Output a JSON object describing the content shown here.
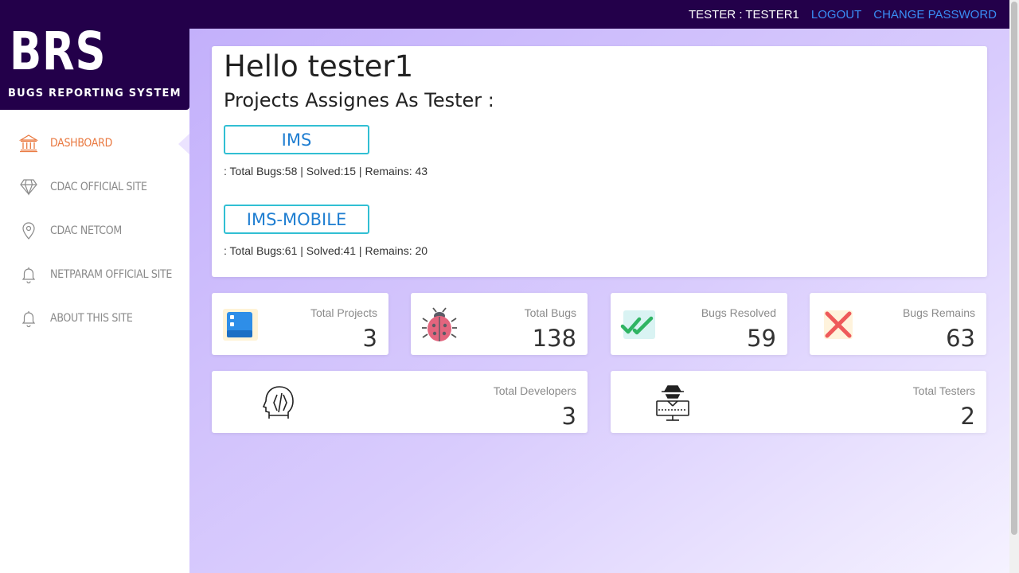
{
  "header": {
    "user_label": "TESTER : TESTER1",
    "logout_label": "LOGOUT",
    "change_password_label": "CHANGE PASSWORD"
  },
  "brand": {
    "logo_text": "BRS",
    "tagline": "BUGS REPORTING SYSTEM"
  },
  "sidebar": {
    "items": [
      {
        "label": "DASHBOARD",
        "icon": "bank-icon",
        "active": true
      },
      {
        "label": "CDAC OFFICIAL SITE",
        "icon": "diamond-icon",
        "active": false
      },
      {
        "label": "CDAC NETCOM",
        "icon": "location-pin-icon",
        "active": false
      },
      {
        "label": "NETPARAM OFFICIAL SITE",
        "icon": "bell-icon",
        "active": false
      },
      {
        "label": "ABOUT THIS SITE",
        "icon": "bell-icon",
        "active": false
      }
    ]
  },
  "greeting": {
    "title": "Hello tester1",
    "subtitle": "Projects Assignes As Tester :"
  },
  "projects": [
    {
      "name": "IMS",
      "stats": ": Total Bugs:58 | Solved:15 | Remains: 43"
    },
    {
      "name": "IMS-MOBILE",
      "stats": ": Total Bugs:61 | Solved:41 | Remains: 20"
    }
  ],
  "stats": [
    {
      "title": "Total Projects",
      "value": "3",
      "icon": "projects-icon"
    },
    {
      "title": "Total Bugs",
      "value": "138",
      "icon": "bug-icon"
    },
    {
      "title": "Bugs Resolved",
      "value": "59",
      "icon": "double-check-icon"
    },
    {
      "title": "Bugs Remains",
      "value": "63",
      "icon": "cross-icon"
    },
    {
      "title": "Total Developers",
      "value": "3",
      "icon": "developer-head-icon"
    },
    {
      "title": "Total Testers",
      "value": "2",
      "icon": "tester-spy-icon"
    }
  ],
  "colors": {
    "topbar": "#23004a",
    "link": "#3a8ef6",
    "active_nav": "#e9783f",
    "project_border": "#31bfd3",
    "project_text": "#1f7ed1",
    "bg_gradient_start": "#c3b0fb",
    "bg_gradient_end": "#f5f2ff"
  }
}
